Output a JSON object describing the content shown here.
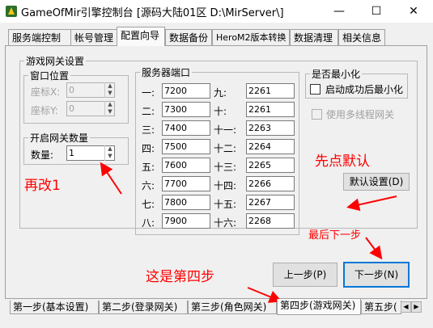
{
  "window": {
    "title": "GameOfMir引擎控制台 [源码大陆01区 D:\\MirServer\\]",
    "min_glyph": "—",
    "max_glyph": "☐",
    "close_glyph": "✕"
  },
  "top_tabs": [
    "服务端控制",
    "帐号管理",
    "配置向导",
    "数据备份",
    "HeroM2版本转换",
    "数据清理",
    "相关信息"
  ],
  "gateway_group": {
    "title": "游戏网关设置",
    "window_position": {
      "title": "窗口位置",
      "x_label": "座标X:",
      "x_value": "0",
      "y_label": "座标Y:",
      "y_value": "0"
    },
    "gate_count": {
      "title": "开启网关数量",
      "label": "数量:",
      "value": "1"
    },
    "ports": {
      "title": "服务器端口",
      "left": [
        {
          "label": "一:",
          "value": "7200"
        },
        {
          "label": "二:",
          "value": "7300"
        },
        {
          "label": "三:",
          "value": "7400"
        },
        {
          "label": "四:",
          "value": "7500"
        },
        {
          "label": "五:",
          "value": "7600"
        },
        {
          "label": "六:",
          "value": "7700"
        },
        {
          "label": "七:",
          "value": "7800"
        },
        {
          "label": "八:",
          "value": "7900"
        }
      ],
      "right": [
        {
          "label": "九:",
          "value": "2261"
        },
        {
          "label": "十:",
          "value": "2261"
        },
        {
          "label": "十一:",
          "value": "2263"
        },
        {
          "label": "十二:",
          "value": "2264"
        },
        {
          "label": "十三:",
          "value": "2265"
        },
        {
          "label": "十四:",
          "value": "2266"
        },
        {
          "label": "十五:",
          "value": "2267"
        },
        {
          "label": "十六:",
          "value": "2268"
        }
      ]
    },
    "minimize": {
      "title": "是否最小化",
      "option": "启动成功后最小化"
    },
    "multithread": "使用多线程网关",
    "default_button": "默认设置(D)"
  },
  "prev_button": "上一步(P)",
  "next_button": "下一步(N)",
  "bottom_tabs": [
    "第一步(基本设置)",
    "第二步(登录网关)",
    "第三步(角色网关)",
    "第四步(游戏网关)",
    "第五步("
  ],
  "annotations": {
    "change_to_1": "再改1",
    "click_default": "先点默认",
    "finally_next": "最后下一步",
    "fourth_step": "这是第四步"
  },
  "colors": {
    "annotation": "#ff0000",
    "focus": "#0078d7"
  }
}
